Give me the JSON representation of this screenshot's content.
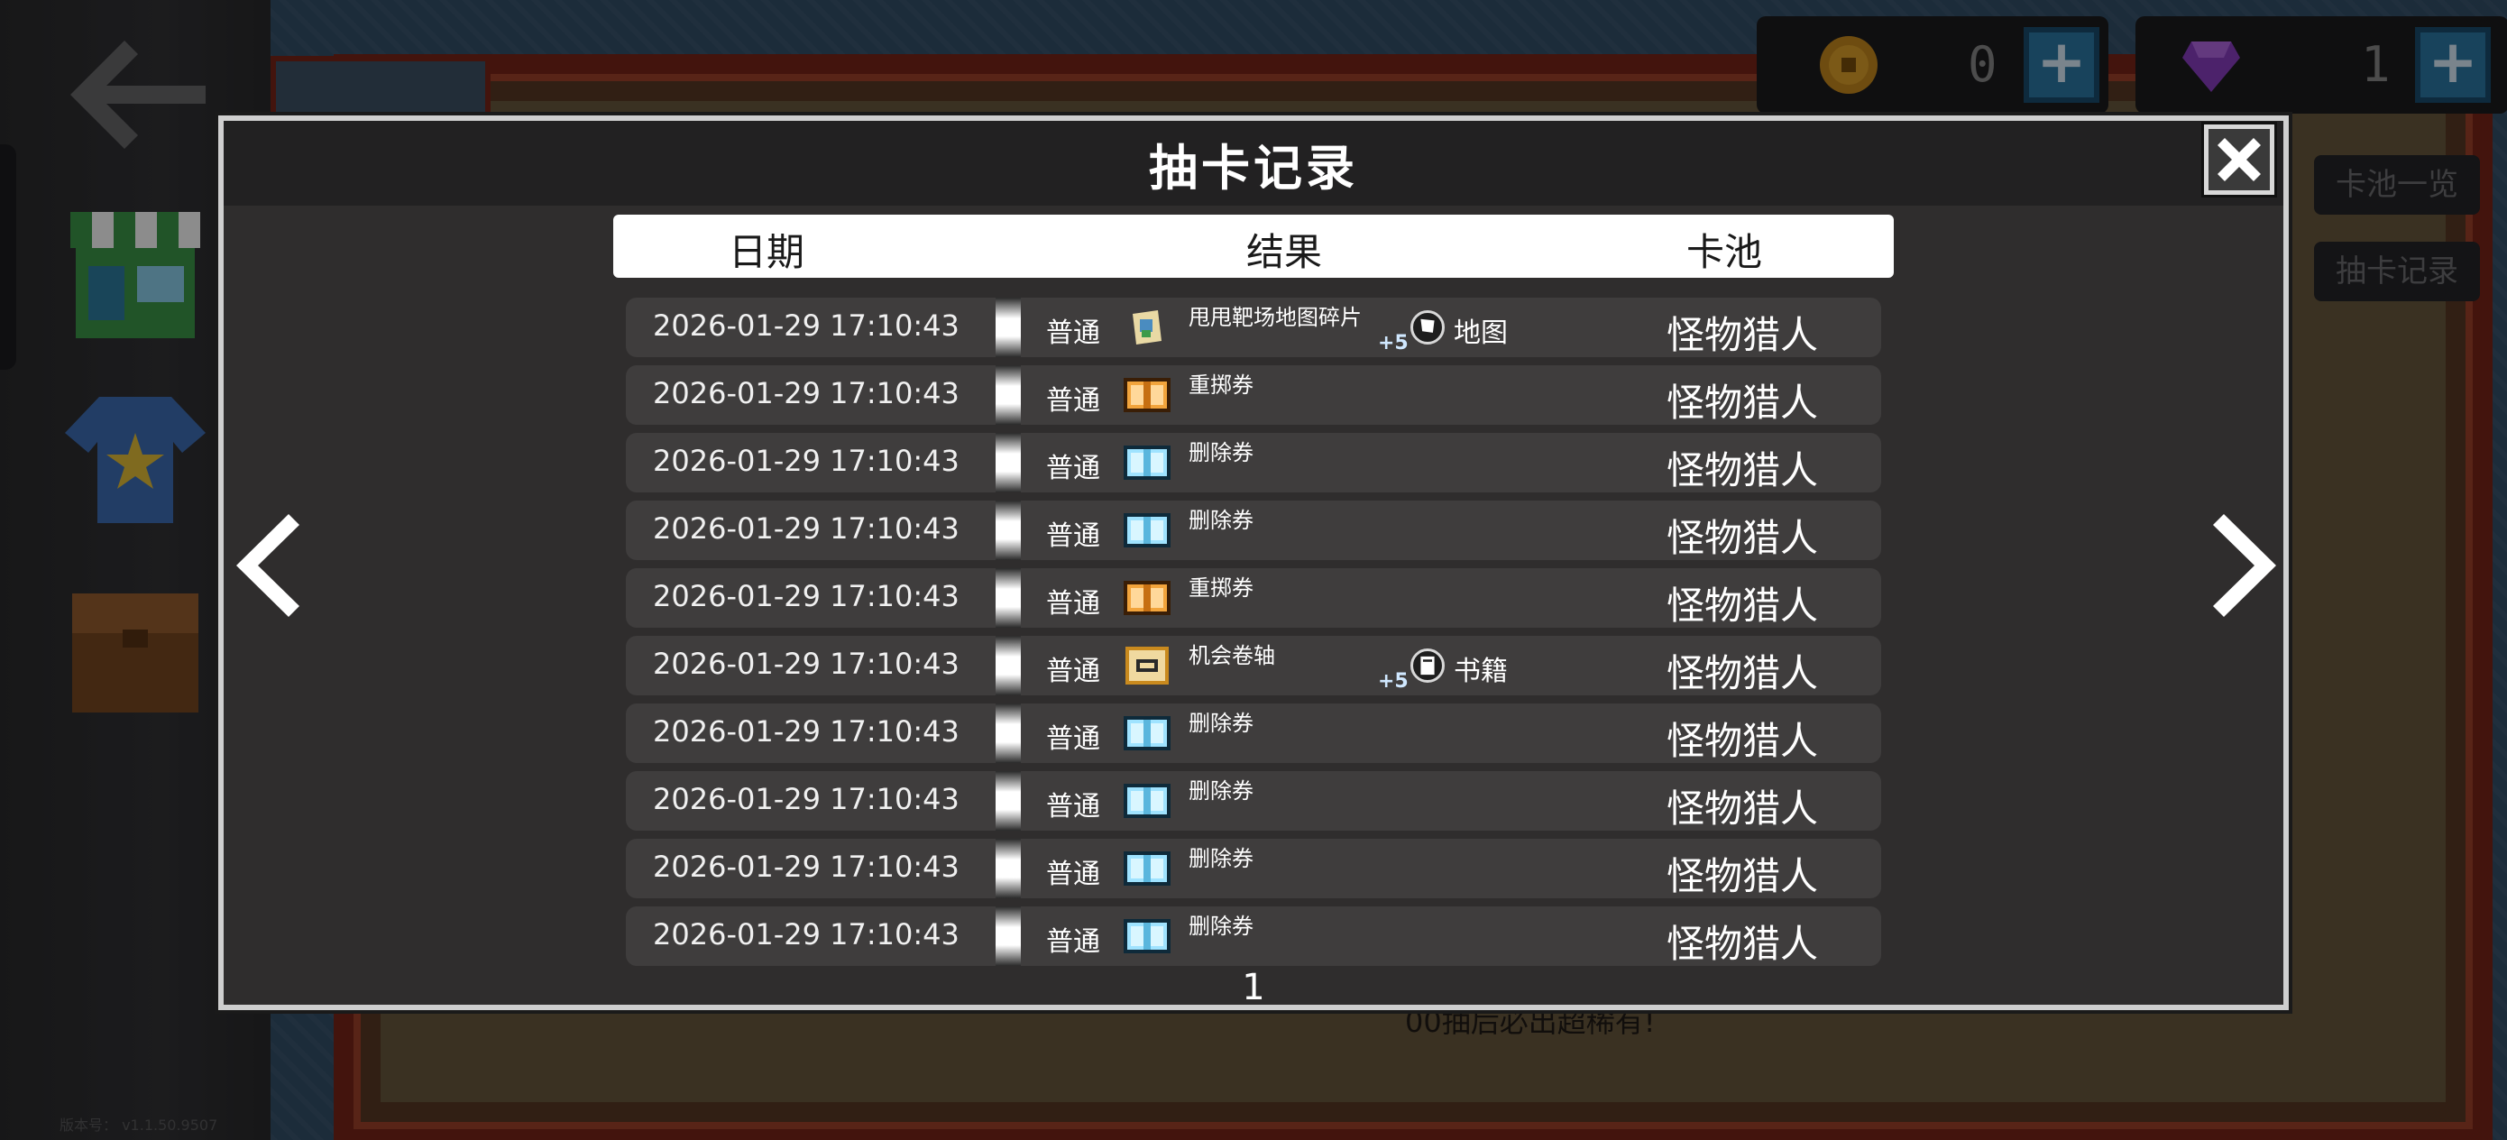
{
  "scene": {
    "version_text": "版本号： v1.1.50.9507",
    "background_text": "00抽后必出超稀有!",
    "coins": "0",
    "gems": "1",
    "side_buttons": [
      "卡池一览",
      "抽卡记录"
    ]
  },
  "dialog": {
    "title": "抽卡记录",
    "columns": {
      "date": "日期",
      "result": "结果",
      "pool": "卡池"
    },
    "rows": [
      {
        "date": "2026-01-29 17:10:43",
        "rarity": "普通",
        "icon": "map-fragment-icon",
        "name": "甩甩靶场地图碎片",
        "plus": "+5",
        "category": "地图",
        "category_icon": "map-flag-icon",
        "pool": "怪物猎人"
      },
      {
        "date": "2026-01-29 17:10:43",
        "rarity": "普通",
        "icon": "orange-ticket-icon",
        "name": "重掷券",
        "plus": "",
        "category": "",
        "category_icon": "",
        "pool": "怪物猎人"
      },
      {
        "date": "2026-01-29 17:10:43",
        "rarity": "普通",
        "icon": "blue-ticket-icon",
        "name": "删除券",
        "plus": "",
        "category": "",
        "category_icon": "",
        "pool": "怪物猎人"
      },
      {
        "date": "2026-01-29 17:10:43",
        "rarity": "普通",
        "icon": "blue-ticket-icon",
        "name": "删除券",
        "plus": "",
        "category": "",
        "category_icon": "",
        "pool": "怪物猎人"
      },
      {
        "date": "2026-01-29 17:10:43",
        "rarity": "普通",
        "icon": "orange-ticket-icon",
        "name": "重掷券",
        "plus": "",
        "category": "",
        "category_icon": "",
        "pool": "怪物猎人"
      },
      {
        "date": "2026-01-29 17:10:43",
        "rarity": "普通",
        "icon": "chance-scroll-icon",
        "name": "机会卷轴",
        "plus": "+5",
        "category": "书籍",
        "category_icon": "book-icon",
        "pool": "怪物猎人"
      },
      {
        "date": "2026-01-29 17:10:43",
        "rarity": "普通",
        "icon": "blue-ticket-icon",
        "name": "删除券",
        "plus": "",
        "category": "",
        "category_icon": "",
        "pool": "怪物猎人"
      },
      {
        "date": "2026-01-29 17:10:43",
        "rarity": "普通",
        "icon": "blue-ticket-icon",
        "name": "删除券",
        "plus": "",
        "category": "",
        "category_icon": "",
        "pool": "怪物猎人"
      },
      {
        "date": "2026-01-29 17:10:43",
        "rarity": "普通",
        "icon": "blue-ticket-icon",
        "name": "删除券",
        "plus": "",
        "category": "",
        "category_icon": "",
        "pool": "怪物猎人"
      },
      {
        "date": "2026-01-29 17:10:43",
        "rarity": "普通",
        "icon": "blue-ticket-icon",
        "name": "删除券",
        "plus": "",
        "category": "",
        "category_icon": "",
        "pool": "怪物猎人"
      }
    ],
    "page": "1"
  },
  "colors": {
    "dialog_bg": "#2f2d2d",
    "row_bg": "#3f3d3d",
    "header_bg": "#ffffff",
    "ticket_blue": "#9fe3ff",
    "ticket_orange": "#f2a43c"
  }
}
